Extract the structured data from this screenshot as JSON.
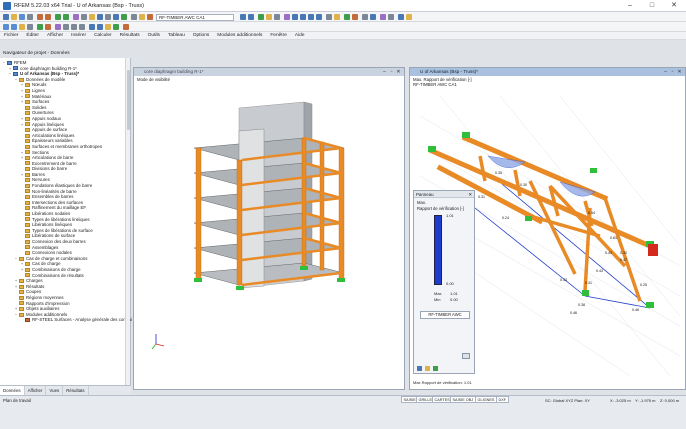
{
  "window": {
    "title": "RFEM 5.22.03 x64 Trial - U of Arkansas (Bsp - Truss)",
    "minimize": "–",
    "maximize": "□",
    "close": "✕"
  },
  "toolbar": {
    "combo_loadcase": "RF-TIMBER AWC CA1"
  },
  "menu": [
    "Fichier",
    "Éditer",
    "Afficher",
    "Insérer",
    "Calculer",
    "Résultats",
    "Outils",
    "Tableau",
    "Options",
    "Modules additionnels",
    "Fenêtre",
    "Aide"
  ],
  "navigator": {
    "title": "Navigateur de projet - Données",
    "items": [
      {
        "label": "RFEM",
        "level": 0,
        "type": "root",
        "exp": "−"
      },
      {
        "label": "core diaphragm building R-1*",
        "level": 1,
        "type": "model",
        "exp": "+"
      },
      {
        "label": "U of Arkansas (Bsp - Truss)*",
        "level": 1,
        "type": "model",
        "exp": "−",
        "bold": true
      },
      {
        "label": "Données de modèle",
        "level": 2,
        "type": "folder",
        "exp": "−"
      },
      {
        "label": "Nœuds",
        "level": 3,
        "type": "folder",
        "exp": "+"
      },
      {
        "label": "Lignes",
        "level": 3,
        "type": "folder",
        "exp": "+"
      },
      {
        "label": "Matériaux",
        "level": 3,
        "type": "folder",
        "exp": "+"
      },
      {
        "label": "Surfaces",
        "level": 3,
        "type": "folder",
        "exp": "+"
      },
      {
        "label": "Solides",
        "level": 3,
        "type": "folder",
        "exp": ""
      },
      {
        "label": "Ouvertures",
        "level": 3,
        "type": "folder",
        "exp": ""
      },
      {
        "label": "Appuis nodaux",
        "level": 3,
        "type": "folder",
        "exp": "+"
      },
      {
        "label": "Appuis linéiques",
        "level": 3,
        "type": "folder",
        "exp": "+"
      },
      {
        "label": "Appuis de surface",
        "level": 3,
        "type": "folder",
        "exp": ""
      },
      {
        "label": "Articulations linéiques",
        "level": 3,
        "type": "folder",
        "exp": ""
      },
      {
        "label": "Épaisseurs variables",
        "level": 3,
        "type": "folder",
        "exp": ""
      },
      {
        "label": "Surfaces et membranes orthotropes",
        "level": 3,
        "type": "folder",
        "exp": ""
      },
      {
        "label": "Sections",
        "level": 3,
        "type": "folder",
        "exp": "+"
      },
      {
        "label": "Articulations de barre",
        "level": 3,
        "type": "folder",
        "exp": "+"
      },
      {
        "label": "Excentrement de barre",
        "level": 3,
        "type": "folder",
        "exp": ""
      },
      {
        "label": "Divisions de barre",
        "level": 3,
        "type": "folder",
        "exp": ""
      },
      {
        "label": "Barres",
        "level": 3,
        "type": "folder",
        "exp": "+"
      },
      {
        "label": "Nervures",
        "level": 3,
        "type": "folder",
        "exp": ""
      },
      {
        "label": "Fondations élastiques de barre",
        "level": 3,
        "type": "folder",
        "exp": ""
      },
      {
        "label": "Non-linéarités de barre",
        "level": 3,
        "type": "folder",
        "exp": ""
      },
      {
        "label": "Ensembles de barres",
        "level": 3,
        "type": "folder",
        "exp": ""
      },
      {
        "label": "Intersections des surfaces",
        "level": 3,
        "type": "folder",
        "exp": ""
      },
      {
        "label": "Raffinement du maillage EF",
        "level": 3,
        "type": "folder",
        "exp": ""
      },
      {
        "label": "Libérations nodales",
        "level": 3,
        "type": "folder",
        "exp": ""
      },
      {
        "label": "Types de libérations linéiques",
        "level": 3,
        "type": "folder",
        "exp": ""
      },
      {
        "label": "Libérations linéiques",
        "level": 3,
        "type": "folder",
        "exp": ""
      },
      {
        "label": "Types de libérations de surface",
        "level": 3,
        "type": "folder",
        "exp": ""
      },
      {
        "label": "Libérations de surface",
        "level": 3,
        "type": "folder",
        "exp": ""
      },
      {
        "label": "Connexion des deux barres",
        "level": 3,
        "type": "folder",
        "exp": ""
      },
      {
        "label": "Assemblages",
        "level": 3,
        "type": "folder",
        "exp": ""
      },
      {
        "label": "Connexions nodales",
        "level": 3,
        "type": "folder",
        "exp": ""
      },
      {
        "label": "Cas de charge et combinaisons",
        "level": 2,
        "type": "folder",
        "exp": "−"
      },
      {
        "label": "Cas de charge",
        "level": 3,
        "type": "folder",
        "exp": "+"
      },
      {
        "label": "Combinaisons de charge",
        "level": 3,
        "type": "folder",
        "exp": "+"
      },
      {
        "label": "Combinaisons de résultats",
        "level": 3,
        "type": "folder",
        "exp": ""
      },
      {
        "label": "Charges",
        "level": 2,
        "type": "folder",
        "exp": "+"
      },
      {
        "label": "Résultats",
        "level": 2,
        "type": "folder",
        "exp": "+"
      },
      {
        "label": "Coupes",
        "level": 2,
        "type": "folder",
        "exp": ""
      },
      {
        "label": "Régions moyennes",
        "level": 2,
        "type": "folder",
        "exp": ""
      },
      {
        "label": "Rapports d'impression",
        "level": 2,
        "type": "folder",
        "exp": ""
      },
      {
        "label": "Objets auxiliaires",
        "level": 2,
        "type": "folder",
        "exp": "+"
      },
      {
        "label": "Modules additionnels",
        "level": 2,
        "type": "folder",
        "exp": "−"
      },
      {
        "label": "RF-STEEL Surfaces - Analyse générale des contrai",
        "level": 3,
        "type": "module",
        "exp": ""
      }
    ],
    "tabs": [
      "Données",
      "Afficher",
      "Vues",
      "Résultats"
    ]
  },
  "view1": {
    "title": "core diaphragm building R-1*",
    "info": "Mode de visibilité"
  },
  "view2": {
    "title": "U of Arkansas (Bsp - Truss)*",
    "info1": "Max. Rapport de vérification [-]",
    "info2": "RF-TIMBER AWC CA1",
    "bottom": "Max Rapport de vérification: 1.01"
  },
  "panel": {
    "title": "Panneau",
    "close": "✕",
    "label1": "Max.",
    "label2": "Rapport de vérification [-]",
    "scale_top": "1.01",
    "scale_bottom": "0.00",
    "max_label": "Max",
    "max_value": "1.01",
    "min_label": "Min",
    "min_value": "0.00",
    "button": "RF-TIMBER AWC"
  },
  "annotations": [
    "0.35",
    "0.30",
    "0.54",
    "0.61",
    "0.43",
    "0.24",
    "0.38",
    "0.31",
    "0.25",
    "0.43",
    "0.30",
    "0.31",
    "0.47",
    "0.43",
    "0.46",
    "0.46"
  ],
  "status": {
    "left": "Plan de travail",
    "tabs": [
      "SAISIE",
      "GRILLE",
      "CARTES",
      "SAISIE OBJ",
      "GLIGNES",
      "DXF"
    ],
    "right": "SC: Global XYZ    Plan: XY",
    "x": "X: -3.025 m",
    "y": "Y: -1.975 m",
    "z": "Z: 0.000 m"
  },
  "colors": {
    "timber": "#e88a26",
    "support": "#2fbf3a",
    "blue_bar": "#1e3dcc",
    "title_active": "#a9c1de"
  }
}
